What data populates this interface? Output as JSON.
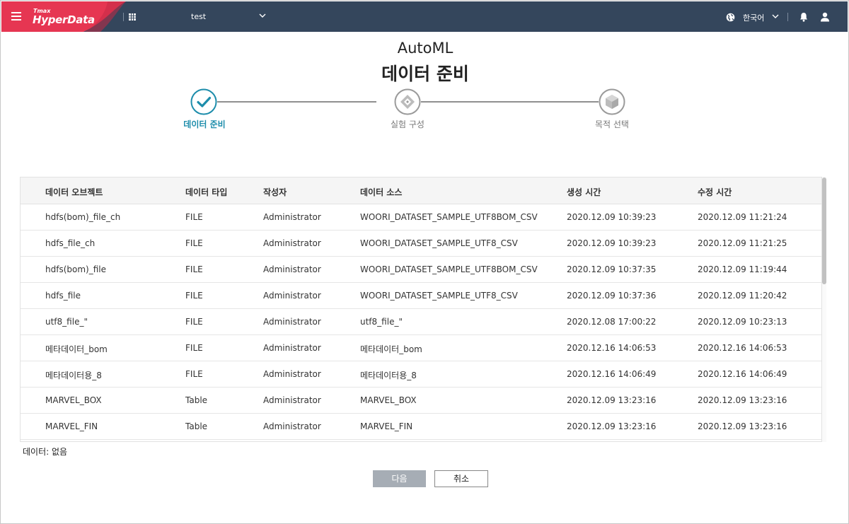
{
  "topbar": {
    "logo_small": "Tmax",
    "logo_main": "HyperData",
    "project": "test",
    "language": "한국어",
    "colors": {
      "bar": "#34465c",
      "brand": "#e63652"
    },
    "icons": [
      "hamburger-icon",
      "apps-grid-icon",
      "chevron-down-icon",
      "globe-icon",
      "bell-icon",
      "user-icon"
    ]
  },
  "page": {
    "subtitle": "AutoML",
    "title": "데이터 준비"
  },
  "stepper": {
    "steps": [
      {
        "label": "데이터 준비",
        "state": "done",
        "icon": "check-icon"
      },
      {
        "label": "실험 구성",
        "state": "pending",
        "icon": "diamond-icon"
      },
      {
        "label": "목적 선택",
        "state": "pending",
        "icon": "cube-icon"
      }
    ],
    "colors": {
      "active": "#1d8dab",
      "inactive": "#9a9a9a"
    }
  },
  "table": {
    "columns": [
      "데이터 오브젝트",
      "데이터 타입",
      "작성자",
      "데이터 소스",
      "생성 시간",
      "수정 시간"
    ],
    "rows": [
      [
        "hdfs(bom)_file_ch",
        "FILE",
        "Administrator",
        "WOORI_DATASET_SAMPLE_UTF8BOM_CSV",
        "2020.12.09 10:39:23",
        "2020.12.09 11:21:24"
      ],
      [
        "hdfs_file_ch",
        "FILE",
        "Administrator",
        "WOORI_DATASET_SAMPLE_UTF8_CSV",
        "2020.12.09 10:39:23",
        "2020.12.09 11:21:25"
      ],
      [
        "hdfs(bom)_file",
        "FILE",
        "Administrator",
        "WOORI_DATASET_SAMPLE_UTF8BOM_CSV",
        "2020.12.09 10:37:35",
        "2020.12.09 11:19:44"
      ],
      [
        "hdfs_file",
        "FILE",
        "Administrator",
        "WOORI_DATASET_SAMPLE_UTF8_CSV",
        "2020.12.09 10:37:36",
        "2020.12.09 11:20:42"
      ],
      [
        "utf8_file_\"",
        "FILE",
        "Administrator",
        "utf8_file_\"",
        "2020.12.08 17:00:22",
        "2020.12.09 10:23:13"
      ],
      [
        "메타데이터_bom",
        "FILE",
        "Administrator",
        "메타데이터_bom",
        "2020.12.16 14:06:53",
        "2020.12.16 14:06:53"
      ],
      [
        "메타데이터용_8",
        "FILE",
        "Administrator",
        "메타데이터용_8",
        "2020.12.16 14:06:49",
        "2020.12.16 14:06:49"
      ],
      [
        "MARVEL_BOX",
        "Table",
        "Administrator",
        "MARVEL_BOX",
        "2020.12.09 13:23:16",
        "2020.12.09 13:23:16"
      ],
      [
        "MARVEL_FIN",
        "Table",
        "Administrator",
        "MARVEL_FIN",
        "2020.12.09 13:23:16",
        "2020.12.09 13:23:16"
      ]
    ]
  },
  "status": {
    "data_selection": "데이터: 없음"
  },
  "buttons": {
    "next": "다음",
    "cancel": "취소"
  }
}
